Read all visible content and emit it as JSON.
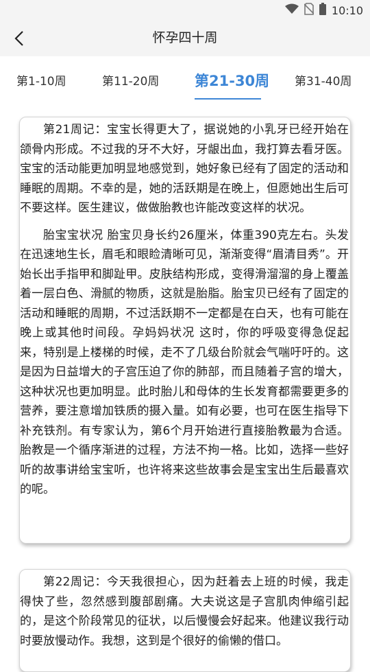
{
  "status_bar": {
    "time": "10:10"
  },
  "header": {
    "title": "怀孕四十周"
  },
  "tabs": [
    {
      "label": "第1-10周"
    },
    {
      "label": "第11-20周"
    },
    {
      "label": "第21-30周"
    },
    {
      "label": "第31-40周"
    }
  ],
  "active_tab": "第21-30周",
  "cards": [
    {
      "paragraphs": [
        "第21周记：宝宝长得更大了，据说她的小乳牙已经开始在颌骨内形成。不过我的牙不大好，牙龈出血，我打算去看牙医。宝宝的活动能更加明显地感觉到，她好象已经有了固定的活动和睡眠的周期。不幸的是，她的活跃期是在晚上，但愿她出生后可不要这样。医生建议，做做胎教也许能改变这样的状况。",
        "胎宝宝状况 胎宝贝身长约26厘米，体重390克左右。头发在迅速地生长，眉毛和眼睑清晰可见，渐渐变得“眉清目秀”。开始长出手指甲和脚趾甲。皮肤结构形成，变得滑溜溜的身上覆盖着一层白色、滑腻的物质，这就是胎脂。胎宝贝已经有了固定的活动和睡眠的周期，不过活跃期不一定都是在白天，也有可能在晚上或其他时间段。孕妈妈状况 这时，你的呼吸变得急促起来，特别是上楼梯的时候，走不了几级台阶就会气喘吁吁的。这是因为日益增大的子宫压迫了你的肺部，而且随着子宫的增大，这种状况也更加明显。此时胎儿和母体的生长发育都需要更多的营养，要注意增加铁质的摄入量。如有必要，也可在医生指导下补充铁剂。有专家认为，第6个月开始进行直接胎教最为合适。胎教是一个循序渐进的过程，方法不拘一格。比如，选择一些好听的故事讲给宝宝听，也许将来这些故事会是宝宝出生后最喜欢的呢。"
      ]
    },
    {
      "paragraphs": [
        "第22周记：今天我很担心，因为赶着去上班的时候，我走得快了些，忽然感到腹部剧痛。大夫说这是子宫肌肉伸缩引起的，是这个阶段常见的征状，以后慢慢会好起来。他建议我行动时要放慢动作。我想，这到是个很好的偷懒的借口。"
      ]
    }
  ]
}
